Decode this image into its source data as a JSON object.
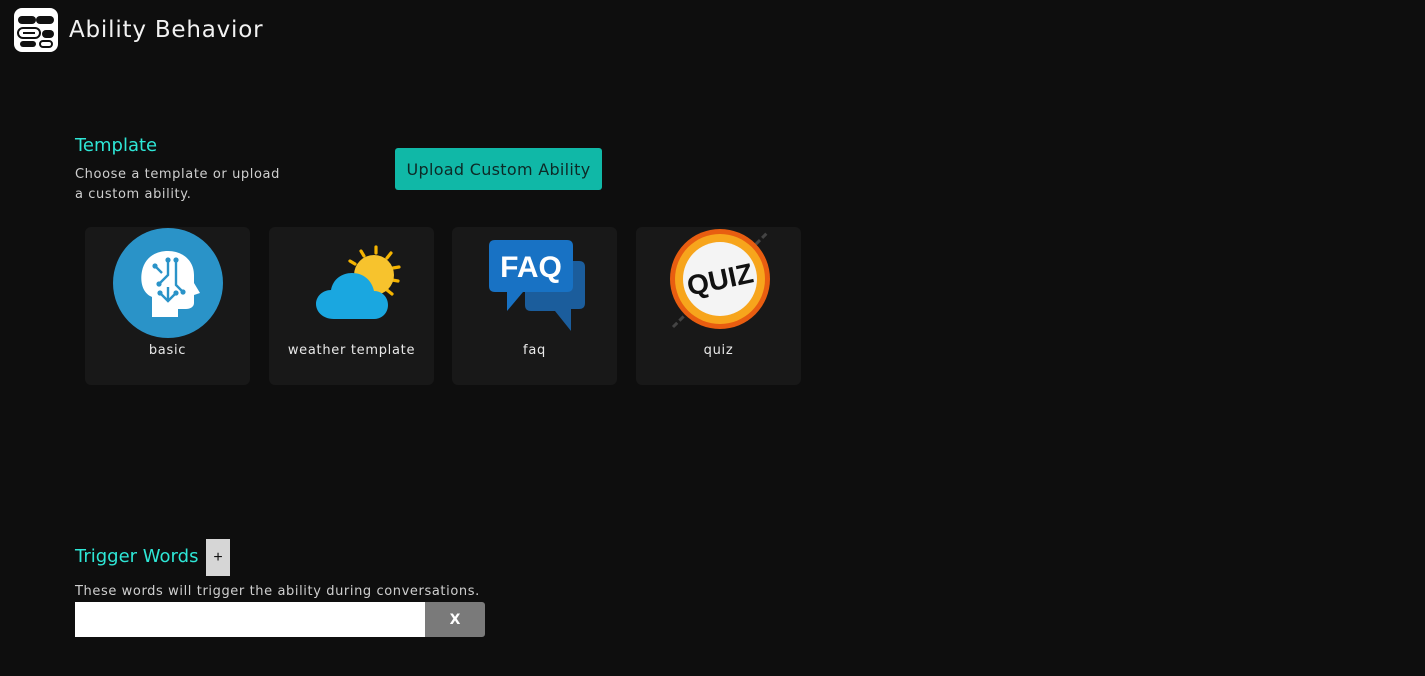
{
  "header": {
    "title": "Ability Behavior",
    "logo_icon": "chat-bubbles-logo-icon"
  },
  "template": {
    "heading": "Template",
    "description_line1": "Choose a template or upload",
    "description_line2": "a custom ability.",
    "upload_label": "Upload Custom Ability",
    "cards": [
      {
        "label": "basic",
        "icon": "ai-head-icon"
      },
      {
        "label": "weather template",
        "icon": "partly-cloudy-icon"
      },
      {
        "label": "faq",
        "icon": "faq-chat-icon"
      },
      {
        "label": "quiz",
        "icon": "quiz-badge-icon"
      }
    ]
  },
  "trigger": {
    "heading": "Trigger Words",
    "add_label": "+",
    "description": "These words will trigger the ability during conversations.",
    "input_value": "",
    "clear_label": "X"
  },
  "colors": {
    "accent": "#2ee6d6",
    "button": "#10b8a7",
    "background": "#0e0e0e",
    "card": "#181818"
  }
}
